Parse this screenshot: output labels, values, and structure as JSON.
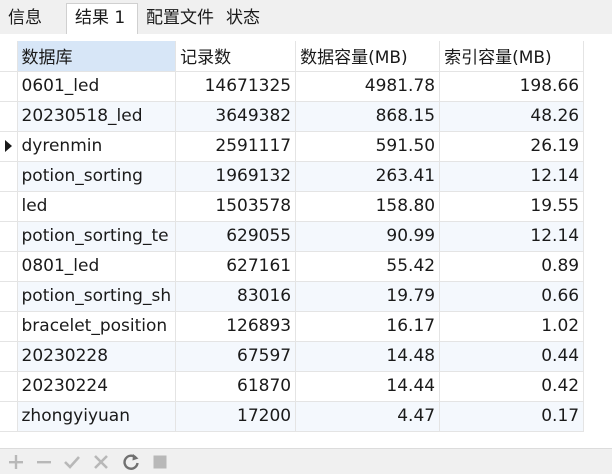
{
  "tabs": [
    {
      "label": "信息",
      "active": false
    },
    {
      "label": "结果 1",
      "active": true
    },
    {
      "label": "配置文件",
      "active": false
    },
    {
      "label": "状态",
      "active": false
    }
  ],
  "grid": {
    "columns": [
      "数据库",
      "记录数",
      "数据容量(MB)",
      "索引容量(MB)"
    ],
    "selected_row_index": 2,
    "rows": [
      [
        "0601_led",
        "14671325",
        "4981.78",
        "198.66"
      ],
      [
        "20230518_led",
        "3649382",
        "868.15",
        "48.26"
      ],
      [
        "dyrenmin",
        "2591117",
        "591.50",
        "26.19"
      ],
      [
        "potion_sorting",
        "1969132",
        "263.41",
        "12.14"
      ],
      [
        "led",
        "1503578",
        "158.80",
        "19.55"
      ],
      [
        "potion_sorting_te",
        "629055",
        "90.99",
        "12.14"
      ],
      [
        "0801_led",
        "627161",
        "55.42",
        "0.89"
      ],
      [
        "potion_sorting_sh",
        "83016",
        "19.79",
        "0.66"
      ],
      [
        "bracelet_position",
        "126893",
        "16.17",
        "1.02"
      ],
      [
        "20230228",
        "67597",
        "14.48",
        "0.44"
      ],
      [
        "20230224",
        "61870",
        "14.44",
        "0.42"
      ],
      [
        "zhongyiyuan",
        "17200",
        "4.47",
        "0.17"
      ]
    ]
  },
  "toolbar": {
    "icons": [
      "plus-icon",
      "minus-icon",
      "check-icon",
      "x-icon",
      "refresh-icon",
      "stop-icon"
    ]
  },
  "colors": {
    "selected_header": "#d7e6f7",
    "alt_row": "#f4f8fd",
    "toolbar_icon": "#b8b8b8"
  }
}
